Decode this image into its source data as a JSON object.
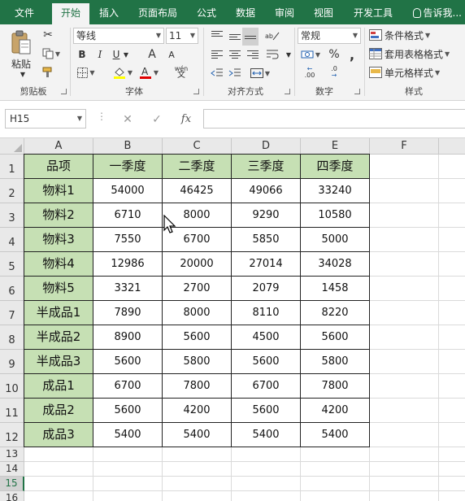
{
  "ribbon": {
    "tabs": [
      "文件",
      "开始",
      "插入",
      "页面布局",
      "公式",
      "数据",
      "审阅",
      "视图",
      "开发工具"
    ],
    "active_tab": "开始",
    "tell_me": "告诉我...",
    "groups": {
      "clipboard": {
        "label": "剪贴板",
        "paste": "粘贴"
      },
      "font": {
        "label": "字体",
        "font_name": "等线",
        "font_size": "11",
        "bold": "B",
        "italic": "I",
        "underline": "U",
        "grow": "A",
        "shrink": "A",
        "phonetic": "wén"
      },
      "alignment": {
        "label": "对齐方式"
      },
      "number": {
        "label": "数字",
        "format": "常规",
        "percent": "%",
        "comma": ",",
        "inc_decimal": ".00",
        "dec_decimal": ".0"
      },
      "styles": {
        "label": "样式",
        "conditional": "条件格式",
        "table_format": "套用表格格式",
        "cell_style": "单元格样式"
      }
    }
  },
  "formula_bar": {
    "name_box": "H15",
    "cancel": "✕",
    "enter": "✓",
    "fx": "fx",
    "value": ""
  },
  "sheet": {
    "columns": [
      "A",
      "B",
      "C",
      "D",
      "E",
      "F"
    ],
    "row_numbers": [
      "1",
      "2",
      "3",
      "4",
      "5",
      "6",
      "7",
      "8",
      "9",
      "10",
      "11",
      "12",
      "13",
      "14",
      "15",
      "16"
    ],
    "active_row": "15",
    "header": [
      "品项",
      "一季度",
      "二季度",
      "三季度",
      "四季度"
    ],
    "rows": [
      [
        "物料1",
        "54000",
        "46425",
        "49066",
        "33240"
      ],
      [
        "物料2",
        "6710",
        "8000",
        "9290",
        "10580"
      ],
      [
        "物料3",
        "7550",
        "6700",
        "5850",
        "5000"
      ],
      [
        "物料4",
        "12986",
        "20000",
        "27014",
        "34028"
      ],
      [
        "物料5",
        "3321",
        "2700",
        "2079",
        "1458"
      ],
      [
        "半成品1",
        "7890",
        "8000",
        "8110",
        "8220"
      ],
      [
        "半成品2",
        "8900",
        "5600",
        "4500",
        "5600"
      ],
      [
        "半成品3",
        "5600",
        "5800",
        "5600",
        "5800"
      ],
      [
        "成品1",
        "6700",
        "7800",
        "6700",
        "7800"
      ],
      [
        "成品2",
        "5600",
        "4200",
        "5600",
        "4200"
      ],
      [
        "成品3",
        "5400",
        "5400",
        "5400",
        "5400"
      ]
    ]
  },
  "colors": {
    "accent": "#217346",
    "label_fill": "#c6e0b4"
  }
}
